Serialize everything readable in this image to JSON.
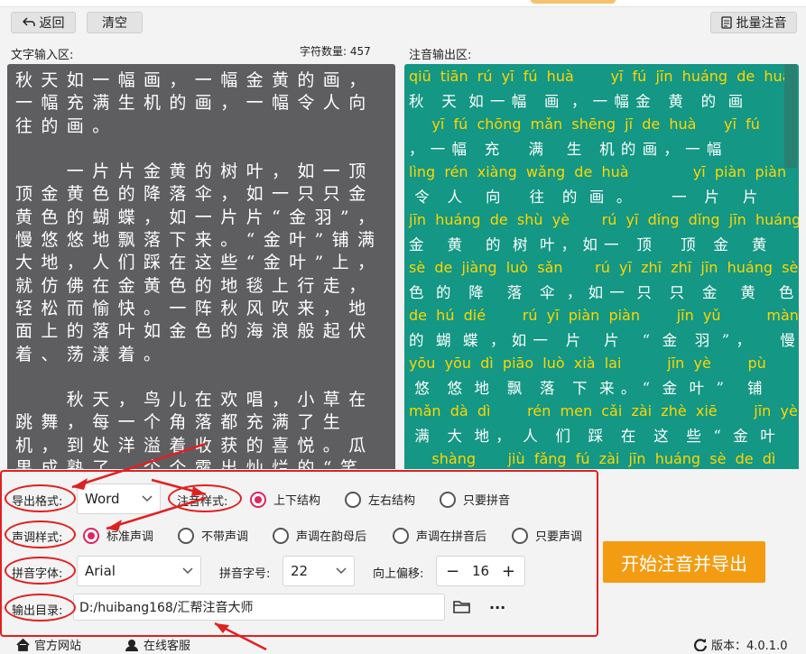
{
  "toolbar": {
    "back_label": "返回",
    "clear_label": "清空",
    "batch_label": "批量注音"
  },
  "input": {
    "title": "文字输入区:",
    "count_label": "字符数量:",
    "count_value": "457",
    "text": "秋天如一幅画，一幅金黄的画，一幅充满生机的画，一幅令人向往的画。\n\n　　一片片金黄的树叶，如一顶顶金黄色的降落伞，如一只只金黄色的蝴蝶，如一片片“金羽”，慢悠悠地飘落下来。“金叶”铺满大地，人们踩在这些“金叶”上，就仿佛在金黄色的地毯上行走，轻松而愉快。一阵秋风吹来，地面上的落叶如金色的海浪般起伏着、荡漾着。\n\n　　秋天，鸟儿在欢唱，小草在跳舞，每一个角落都充满了生机，到处洋溢着收获的喜悦。瓜果成熟了，个个露出灿烂的“笑容”，葡萄"
  },
  "output": {
    "title": "注音输出区:",
    "rows": [
      {
        "py": "qiū  tiān  rú  yī  fú  huà        yī  fú  jīn  huáng  de  huà",
        "hz": "秋   天  如 一 幅   画  ， 一 幅 金   黄   的  画"
      },
      {
        "py": "     yī  fú  chōng  mǎn  shēng  jī  de  huà      yī  fú",
        "hz": "， 一 幅   充     满    生   机 的 画 ， 一 幅"
      },
      {
        "py": "lìng  rén  xiàng  wǎng  de  huà              yī  piàn  piàn",
        "hz": " 令   人    向     往   的  画  。       一   片    片"
      },
      {
        "py": "jīn  huáng  de  shù  yè       rú  yī  dǐng  dǐng  jīn  huáng",
        "hz": "金    黄    的  树  叶 ， 如 一   顶     顶   金    黄"
      },
      {
        "py": "sè  de  jiàng  luò  sǎn       rú  yī  zhī  zhī  jīn  huáng  sè",
        "hz": "色  的   降    落   伞  ， 如 一  只   只   金    黄    色"
      },
      {
        "py": "de  hú  dié        rú  yī  piàn  piàn        jīn  yǔ          màn",
        "hz": "的  蝴  蝶  ， 如 一   片    片    “  金   羽  ” ，     慢"
      },
      {
        "py": "yōu  yōu  dì  piāo  luò  xià  lai          jīn  yè        pù",
        "hz": " 悠   悠  地   飘   落   下  来 。 “  金  叶  ”    铺"
      },
      {
        "py": "mǎn  dà  dì        rén  men  cǎi  zài  zhè  xiē        jīn  yè",
        "hz": " 满   大  地 ，  人   们   踩   在   这   些  “  金  叶"
      },
      {
        "py": "     shàng       jiù  fǎng  fú  zài  jīn  huáng  sè  de  dì",
        "hz": "”    上    ，   就   仿   佛  在  金    黄    色  的  地"
      }
    ]
  },
  "settings": {
    "export_format_label": "导出格式:",
    "export_format_value": "Word",
    "annotation_style_label": "注音样式:",
    "annotation_options": [
      "上下结构",
      "左右结构",
      "只要拼音"
    ],
    "annotation_selected": 0,
    "tone_style_label": "声调样式:",
    "tone_options": [
      "标准声调",
      "不带声调",
      "声调在韵母后",
      "声调在拼音后",
      "只要声调"
    ],
    "tone_selected": 0,
    "pinyin_font_label": "拼音字体:",
    "pinyin_font_value": "Arial",
    "pinyin_size_label": "拼音字号:",
    "pinyin_size_value": "22",
    "offset_label": "向上偏移:",
    "offset_value": "16",
    "minus": "−",
    "plus": "+",
    "output_dir_label": "输出目录:",
    "output_dir_value": "D:/huibang168/汇帮注音大师",
    "more": "···",
    "start_label": "开始注音并导出"
  },
  "footer": {
    "website_label": "官方网站",
    "support_label": "在线客服",
    "version_label": "版本：4.0.1.0"
  },
  "colors": {
    "accent": "#149784",
    "pinyin": "#ffd600",
    "start": "#f39c12",
    "highlight": "#e02020",
    "radio_on": "#e0245e"
  }
}
